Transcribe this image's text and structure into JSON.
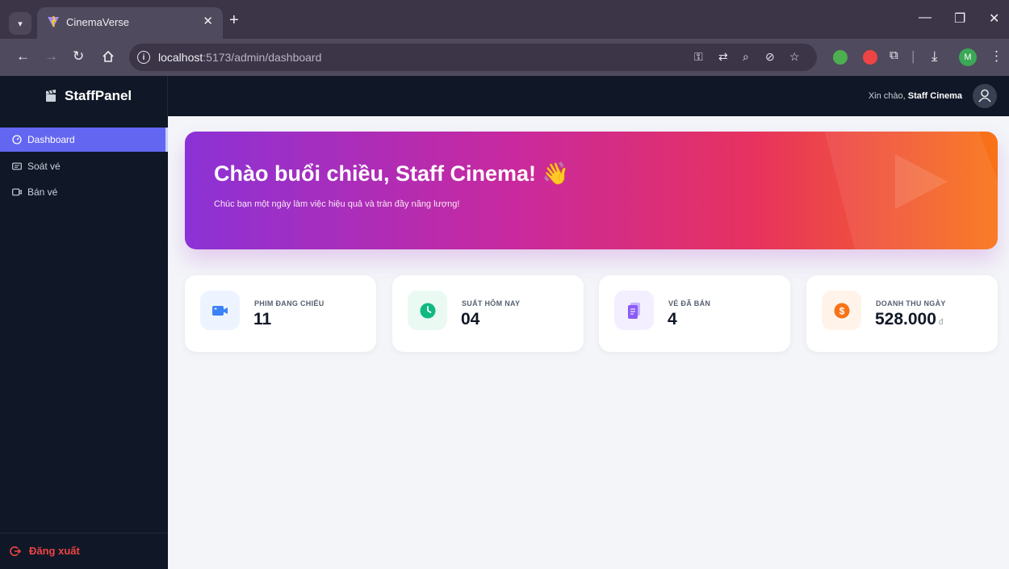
{
  "browser": {
    "tab_title": "CinemaVerse",
    "tab_close": "✕",
    "new_tab": "+",
    "url_host": "localhost",
    "url_rest": ":5173/admin/dashboard",
    "profile_initial": "M",
    "window_controls": [
      "—",
      "❐",
      "✕"
    ]
  },
  "app": {
    "brand": "StaffPanel",
    "greeting_prefix": "Xin chào,",
    "user_name": "Staff Cinema"
  },
  "sidebar": {
    "items": [
      {
        "label": "Dashboard",
        "icon": "dashboard-icon",
        "active": true
      },
      {
        "label": "Soát vé",
        "icon": "ticket-check-icon",
        "active": false
      },
      {
        "label": "Bán vé",
        "icon": "ticket-sell-icon",
        "active": false
      }
    ],
    "logout_label": "Đăng xuất"
  },
  "banner": {
    "title": "Chào buổi chiều, Staff Cinema!",
    "emoji": "👋",
    "subtitle": "Chúc bạn một ngày làm việc hiệu quả và tràn đầy năng lượng!"
  },
  "stats": [
    {
      "label": "PHIM ĐANG CHIẾU",
      "value": "11",
      "unit": "",
      "icon": "video-camera-icon",
      "color": "#3b82f6",
      "bg": "#eef4ff"
    },
    {
      "label": "SUẤT HÔM NAY",
      "value": "04",
      "unit": "",
      "icon": "clock-icon",
      "color": "#10b981",
      "bg": "#eafaf3"
    },
    {
      "label": "VÉ ĐÃ BÁN",
      "value": "4",
      "unit": "",
      "icon": "tickets-icon",
      "color": "#8b5cf6",
      "bg": "#f3efff"
    },
    {
      "label": "DOANH THU NGÀY",
      "value": "528.000",
      "unit": "đ",
      "icon": "dollar-icon",
      "color": "#f97316",
      "bg": "#fff3ea"
    }
  ],
  "colors": {
    "sidebar_bg": "#101827",
    "active_item": "#6366f1",
    "logout": "#ef4444",
    "page_bg": "#f3f5f9",
    "banner_gradient": [
      "#8b32d6",
      "#c8299f",
      "#e7325f",
      "#f97316"
    ]
  }
}
